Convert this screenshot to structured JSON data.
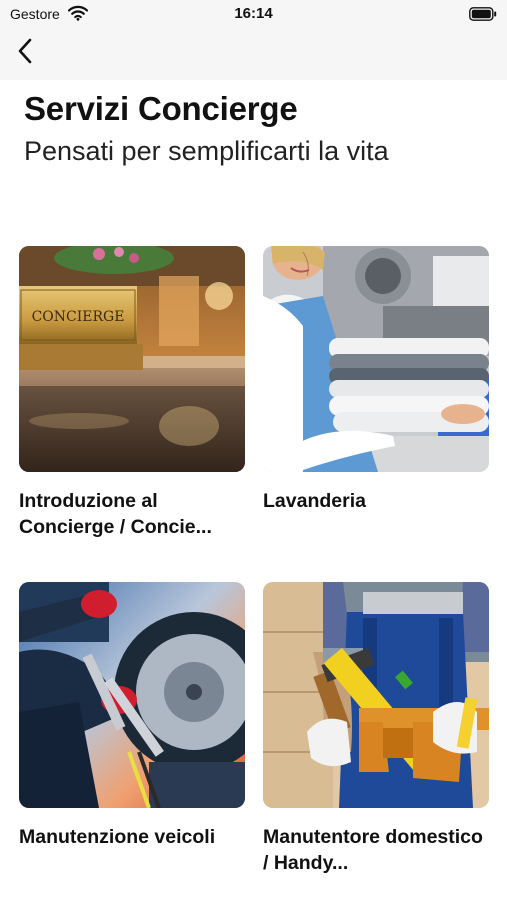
{
  "status_bar": {
    "carrier": "Gestore",
    "time": "16:14",
    "wifi_icon": "wifi-icon",
    "battery_icon": "battery-icon"
  },
  "nav": {
    "back_icon": "chevron-left-icon"
  },
  "header": {
    "title": "Servizi Concierge",
    "subtitle": "Pensati per semplificarti la vita"
  },
  "services": [
    {
      "label": "Introduzione al Concierge / Concie...",
      "image": "concierge-desk-photo"
    },
    {
      "label": "Lavanderia",
      "image": "laundry-towels-photo"
    },
    {
      "label": "Manutenzione veicoli",
      "image": "vehicle-maintenance-photo"
    },
    {
      "label": "Manutentore domestico / Handy...",
      "image": "handyman-tools-photo"
    }
  ]
}
